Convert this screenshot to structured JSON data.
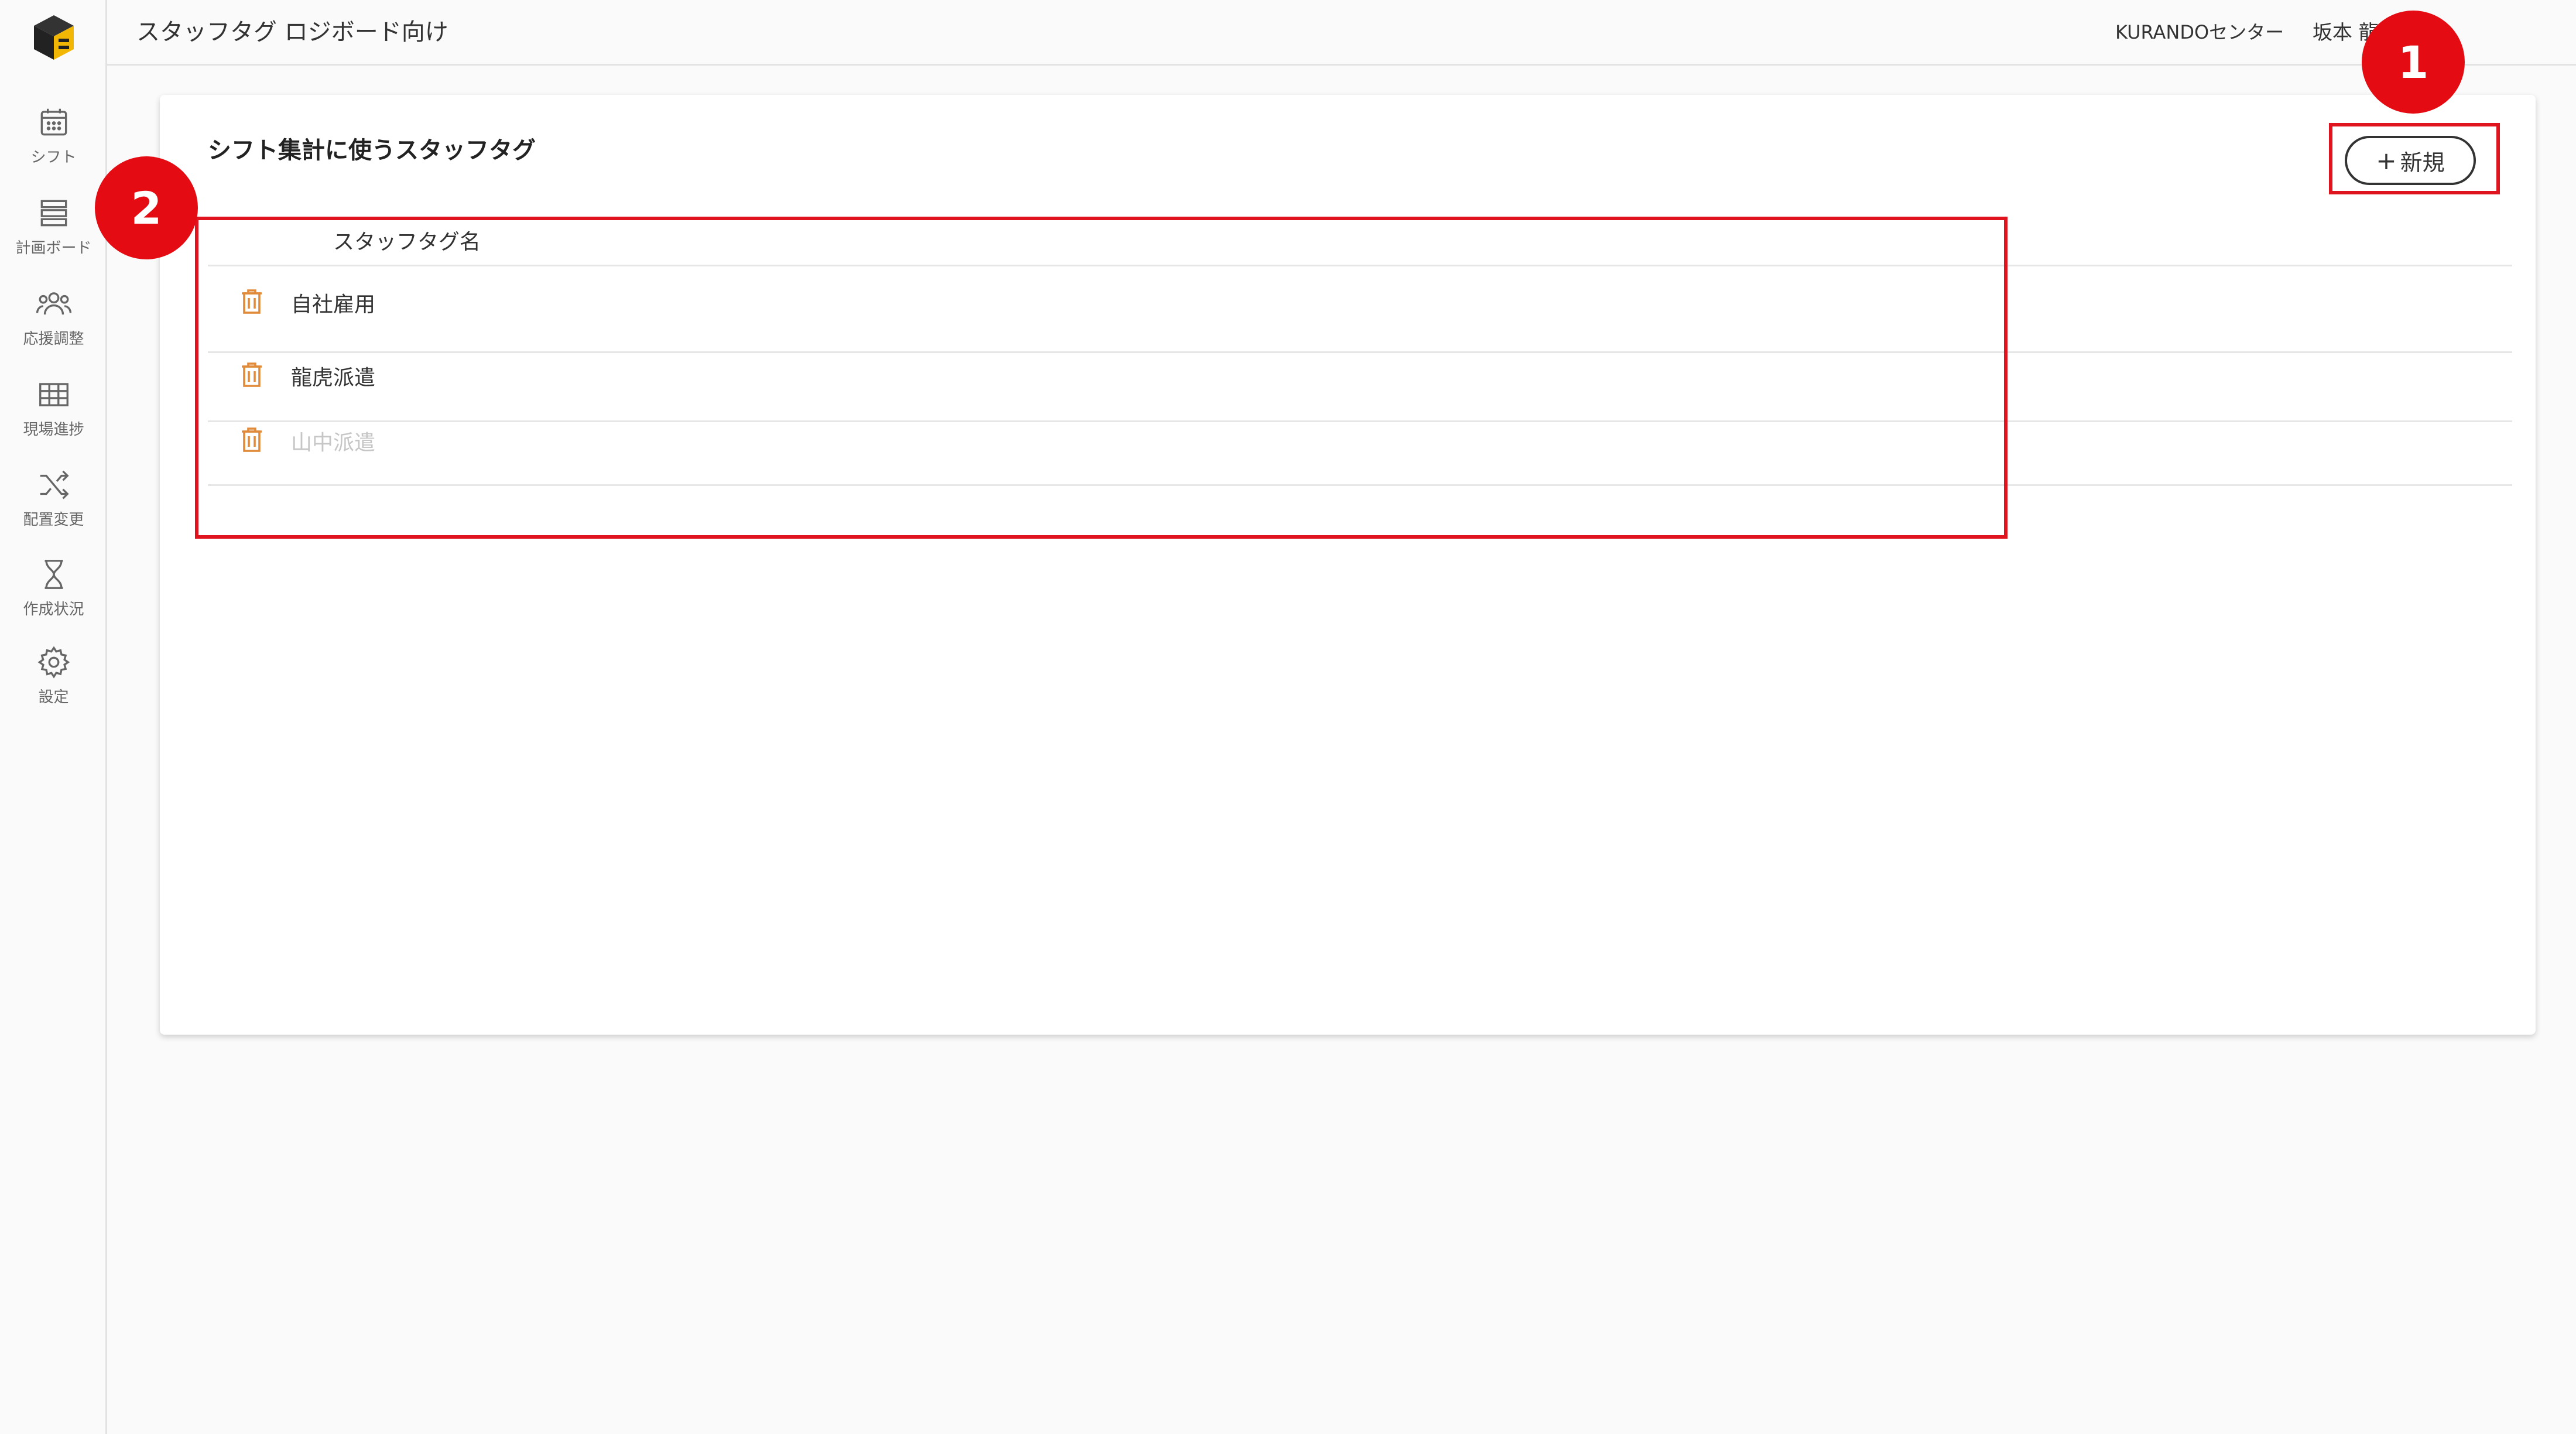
{
  "sidebar": {
    "logo_icon": "cube-logo-icon",
    "items": [
      {
        "label": "シフト",
        "icon": "calendar-icon"
      },
      {
        "label": "計画ボード",
        "icon": "board-icon"
      },
      {
        "label": "応援調整",
        "icon": "people-icon"
      },
      {
        "label": "現場進捗",
        "icon": "grid-icon"
      },
      {
        "label": "配置変更",
        "icon": "shuffle-icon"
      },
      {
        "label": "作成状況",
        "icon": "hourglass-icon"
      },
      {
        "label": "設定",
        "icon": "gear-icon"
      }
    ]
  },
  "header": {
    "title": "スタッフタグ ロジボード向け",
    "center": "KURANDOセンター",
    "user": "坂本 龍",
    "logout_icon": "logout-icon"
  },
  "card": {
    "title": "シフト集計に使うスタッフタグ",
    "new_button_label": "新規",
    "column_header": "スタッフタグ名",
    "rows": [
      {
        "label": "自社雇用",
        "enabled": true
      },
      {
        "label": "龍虎派遣",
        "enabled": true
      },
      {
        "label": "山中派遣",
        "enabled": false
      }
    ]
  },
  "annotations": {
    "marker1": "1",
    "marker2": "2",
    "highlight_color": "#e0141e"
  },
  "colors": {
    "trash": "#e08a3a",
    "marker": "#e40b12"
  }
}
